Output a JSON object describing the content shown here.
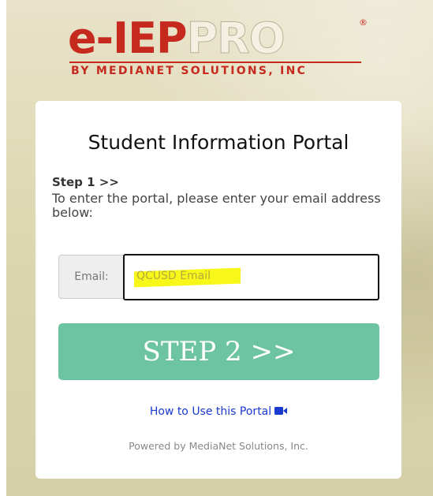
{
  "logo": {
    "e_part": "e-",
    "iep_part": "IEP",
    "pro_part": "PRO",
    "registered": "®",
    "subtitle": "BY MEDIANET SOLUTIONS, INC"
  },
  "card": {
    "title": "Student Information Portal",
    "step_label": "Step 1 >>",
    "instructions": "To enter the portal, please enter your email address below:",
    "email_label": "Email:",
    "email_value": "",
    "email_placeholder": "QCUSD Email",
    "step2_button": "STEP 2 >>",
    "help_link": "How to Use this Portal",
    "help_icon": "video-camera-icon",
    "powered_by": "Powered by MediaNet Solutions, Inc."
  },
  "colors": {
    "brand_red": "#c62a1e",
    "button_green": "#6cc4a2",
    "link_blue": "#1a39cf",
    "highlight_yellow": "#f7f71a"
  }
}
